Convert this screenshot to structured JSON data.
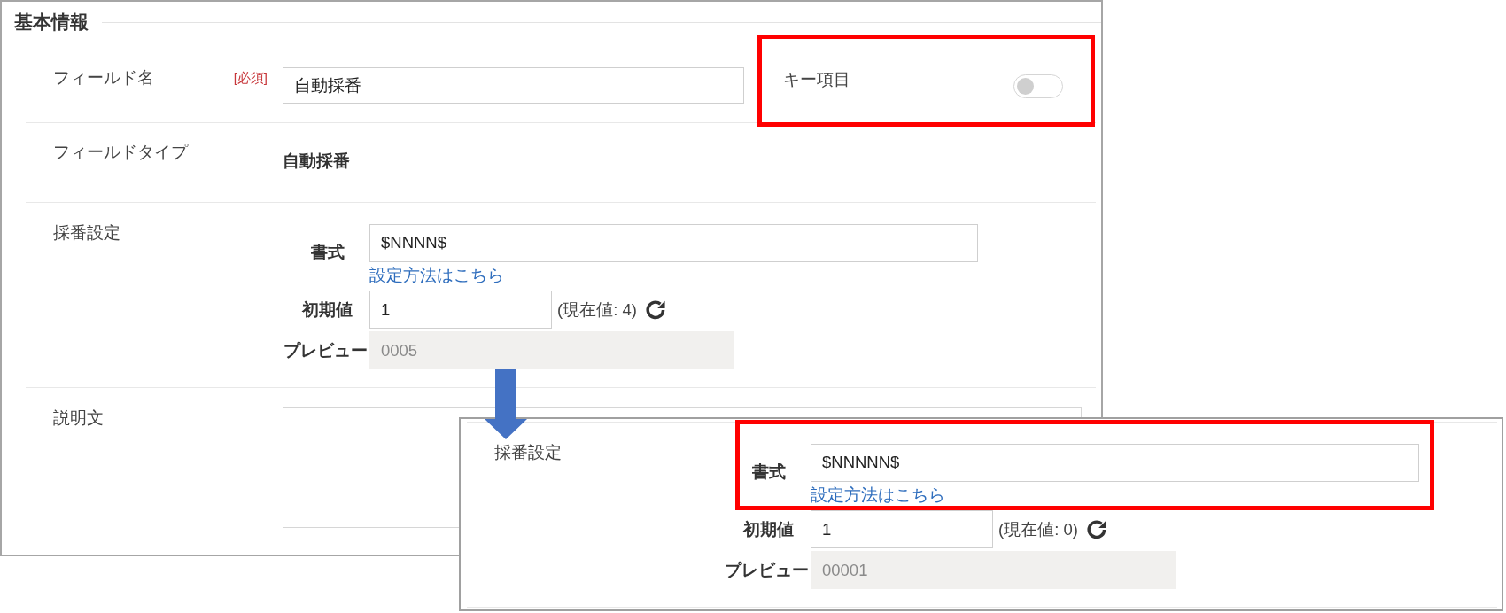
{
  "main_panel": {
    "section_title": "基本情報",
    "field_name": {
      "label": "フィールド名",
      "required_badge": "[必須]",
      "value": "自動採番"
    },
    "key_item": {
      "label": "キー項目",
      "on": false,
      "highlighted": true
    },
    "field_type": {
      "label": "フィールドタイプ",
      "value": "自動採番"
    },
    "numbering": {
      "label": "採番設定",
      "format": {
        "label": "書式",
        "value": "$NNNN$",
        "help_link": "設定方法はこちら",
        "highlighted": false
      },
      "initial_value": {
        "label": "初期値",
        "value": "1",
        "current": "(現在値: 4)"
      },
      "preview": {
        "label": "プレビュー",
        "value": "0005"
      }
    },
    "description": {
      "label": "説明文"
    }
  },
  "inset_panel": {
    "numbering": {
      "label": "採番設定",
      "format": {
        "label": "書式",
        "value": "$NNNNN$",
        "help_link": "設定方法はこちら",
        "highlighted": true
      },
      "initial_value": {
        "label": "初期値",
        "value": "1",
        "current": "(現在値: 0)"
      },
      "preview": {
        "label": "プレビュー",
        "value": "00001"
      }
    }
  }
}
